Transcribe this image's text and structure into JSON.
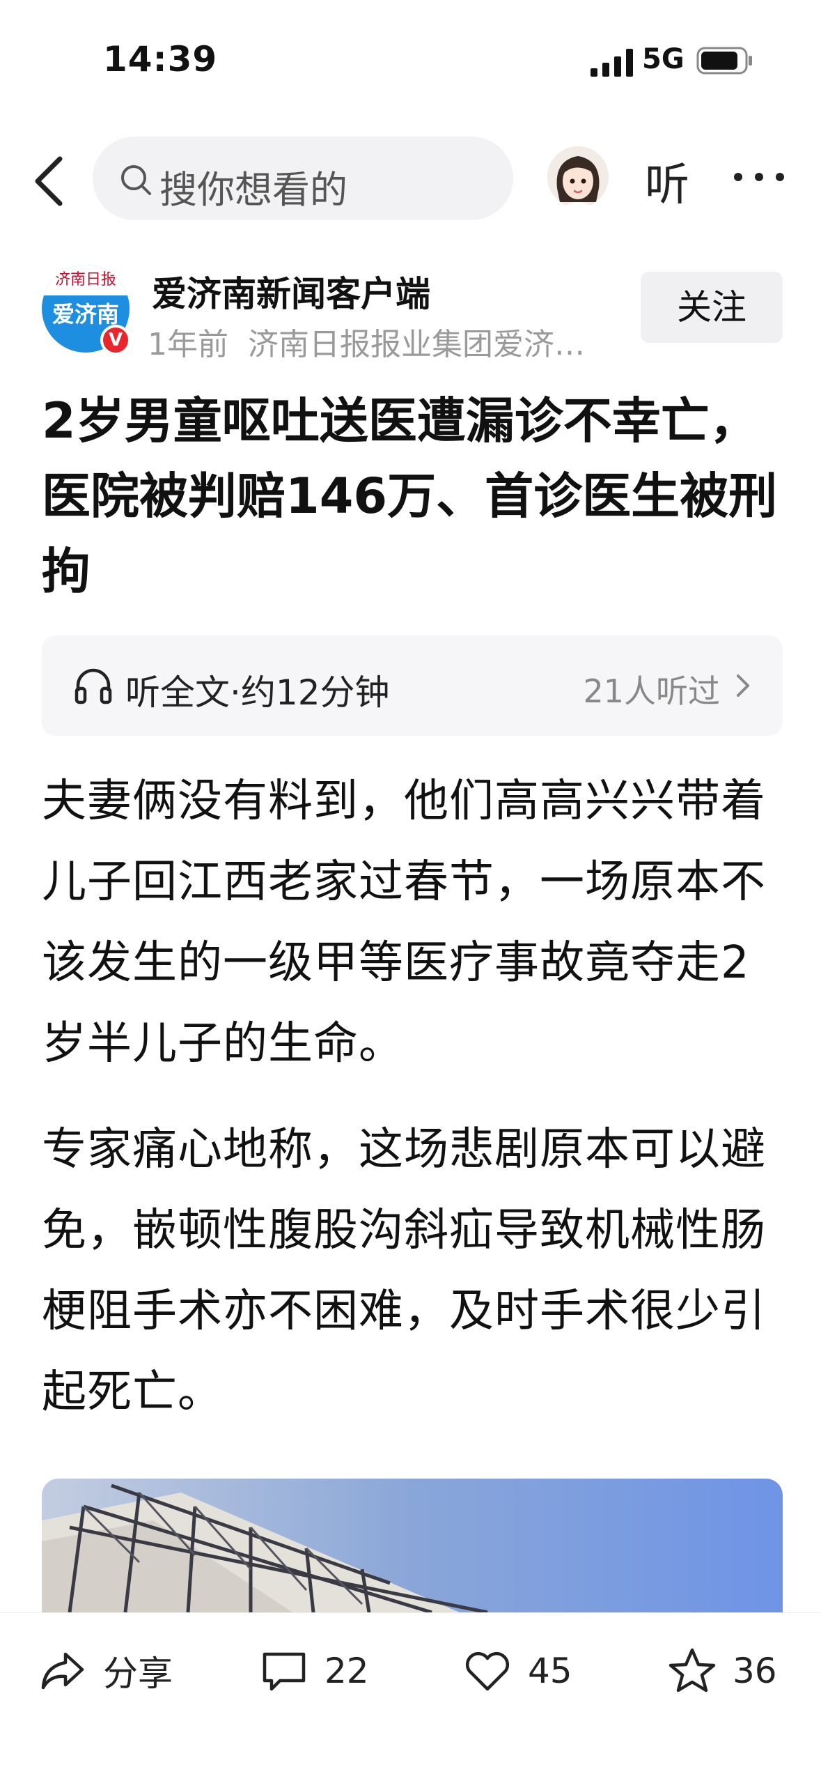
{
  "status_bar": {
    "time": "14:39",
    "network": "5G"
  },
  "nav": {
    "search_placeholder": "搜你想看的",
    "listen_label": "听"
  },
  "author": {
    "logo_top": "济南日报",
    "logo_main": "爱济南",
    "badge": "V",
    "name": "爱济南新闻客户端",
    "time_ago": "1年前",
    "source": "济南日报报业集团爱济…",
    "follow_label": "关注"
  },
  "article": {
    "title": "2岁男童呕吐送医遭漏诊不幸亡，医院被判赔146万、首诊医生被刑拘",
    "listen_full": "听全文·约12分钟",
    "listen_count": "21人听过",
    "paragraphs": [
      "夫妻俩没有料到，他们高高兴兴带着儿子回江西老家过春节，一场原本不该发生的一级甲等医疗事故竟夺走2岁半儿子的生命。",
      "专家痛心地称，这场悲剧原本可以避免，嵌顿性腹股沟斜疝导致机械性肠梗阻手术亦不困难，及时手术很少引起死亡。"
    ]
  },
  "actions": {
    "share_label": "分享",
    "comment_count": "22",
    "like_count": "45",
    "favorite_count": "36"
  }
}
